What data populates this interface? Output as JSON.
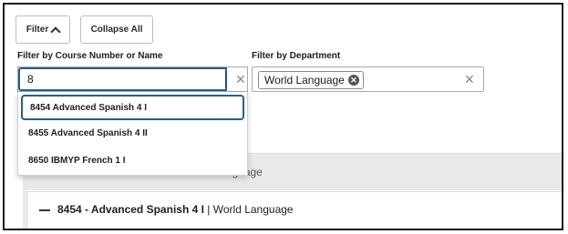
{
  "toolbar": {
    "filter_label": "Filter",
    "collapse_label": "Collapse All"
  },
  "filters": {
    "course_label": "Filter by Course Number or Name",
    "course_value": "8",
    "department_label": "Filter by Department",
    "department_tag": "World Language"
  },
  "suggestions": [
    {
      "label": "8454 Advanced Spanish 4 I",
      "highlighted": true
    },
    {
      "label": "8455 Advanced Spanish 4 II",
      "highlighted": false
    },
    {
      "label": "8650 IBMYP French 1 I",
      "highlighted": false
    }
  ],
  "course_group": {
    "partial_text": "World Language"
  },
  "course_row": {
    "title": "8454 - Advanced Spanish 4 I",
    "department": "| World Language"
  },
  "colors": {
    "focus_border": "#2b5f8a",
    "band_grey": "#e9e9e9"
  },
  "icons": {
    "filter_toggle": "chevron-up-icon",
    "clear": "close-icon",
    "tag_remove": "remove-circle-icon",
    "collapse_row": "minus-icon"
  }
}
